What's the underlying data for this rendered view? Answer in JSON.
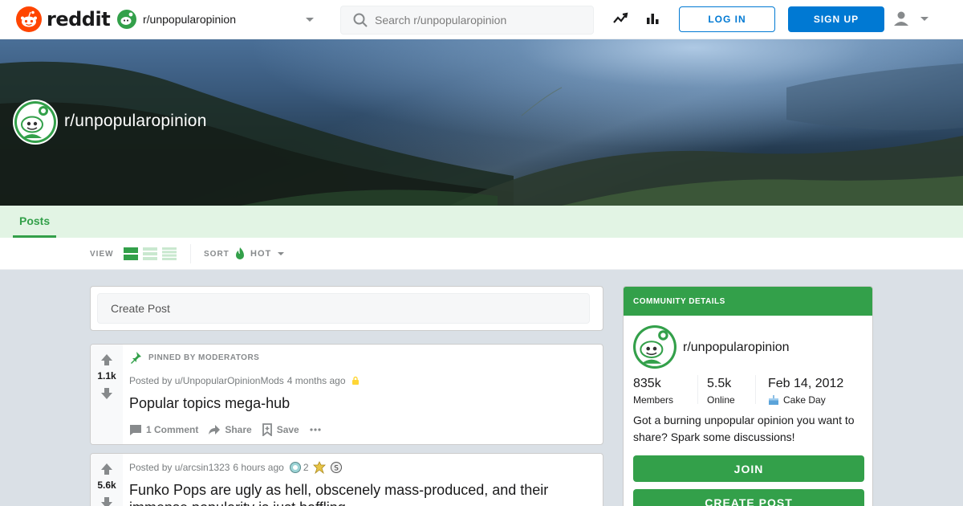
{
  "header": {
    "logo_text": "reddit",
    "subreddit": "r/unpopularopinion",
    "search_placeholder": "Search r/unpopularopinion",
    "login_label": "LOG IN",
    "signup_label": "SIGN UP"
  },
  "banner": {
    "title": "r/unpopularopinion"
  },
  "tabs": [
    {
      "label": "Posts",
      "active": true
    }
  ],
  "viewbar": {
    "view_label": "VIEW",
    "sort_label": "SORT",
    "sort_value": "HOT"
  },
  "create_post": {
    "placeholder": "Create Post"
  },
  "posts": [
    {
      "pinned_label": "PINNED BY MODERATORS",
      "votes": "1.1k",
      "posted_by": "Posted by u/UnpopularOpinionMods",
      "time": "4 months ago",
      "title": "Popular topics mega-hub",
      "comments": "1 Comment",
      "share": "Share",
      "save": "Save"
    },
    {
      "votes": "5.6k",
      "posted_by": "Posted by u/arcsin1323",
      "time": "6 hours ago",
      "award_count": "2",
      "title": "Funko Pops are ugly as hell, obscenely mass-produced, and their immense popularity is just baffling"
    }
  ],
  "sidebar": {
    "header": "COMMUNITY DETAILS",
    "name": "r/unpopularopinion",
    "members_count": "835k",
    "members_label": "Members",
    "online_count": "5.5k",
    "online_label": "Online",
    "cake_date": "Feb 14, 2012",
    "cake_label": "Cake Day",
    "description": "Got a burning unpopular opinion you want to share? Spark some discussions!",
    "join_label": "JOIN",
    "create_label": "CREATE POST"
  },
  "colors": {
    "brand_orange": "#ff4500",
    "accent_green": "#33a04a",
    "link_blue": "#0079d3"
  }
}
